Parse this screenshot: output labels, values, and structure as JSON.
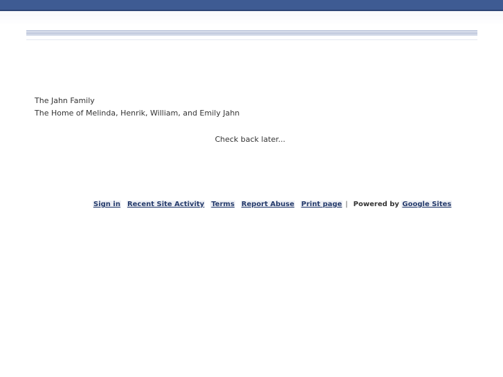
{
  "site": {
    "title": "The Jahn Family",
    "description": "The Home of Melinda, Henrik, William, and Emily Jahn"
  },
  "main": {
    "message": "Check back later..."
  },
  "footer": {
    "sign_in": "Sign in",
    "recent_site_activity": "Recent Site Activity",
    "terms": "Terms",
    "report_abuse": "Report Abuse",
    "print_page": "Print page",
    "separator": "|",
    "powered_by": "Powered by",
    "google_sites": "Google Sites"
  },
  "colors": {
    "top_bar": "#3e5b93",
    "link": "#243a6b",
    "text": "#333333"
  }
}
